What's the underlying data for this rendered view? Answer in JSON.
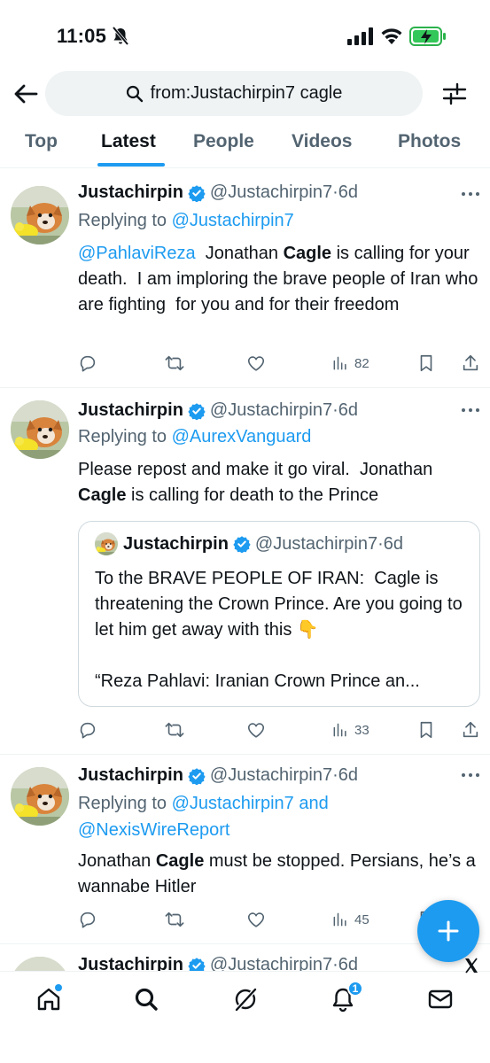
{
  "status_bar": {
    "time": "11:05"
  },
  "search": {
    "query": "from:Justachirpin7 cagle"
  },
  "tabs": [
    {
      "label": "Top"
    },
    {
      "label": "Latest"
    },
    {
      "label": "People"
    },
    {
      "label": "Videos"
    },
    {
      "label": "Photos"
    }
  ],
  "tweets": [
    {
      "name": "Justachirpin",
      "handle": "@Justachirpin7",
      "sep": " · ",
      "time": "6d",
      "replying_prefix": "Replying to ",
      "replying_to": "@Justachirpin7",
      "mention": "@PahlaviReza",
      "text_a": "  Jonathan ",
      "bold": "Cagle",
      "text_b": " is calling for your death.  I am imploring the brave people of Iran who are fighting  for you and for their freedom",
      "views": "82"
    },
    {
      "name": "Justachirpin",
      "handle": "@Justachirpin7",
      "sep": " · ",
      "time": "6d",
      "replying_prefix": "Replying to ",
      "replying_to": "@AurexVanguard",
      "text_a": "Please repost and make it go viral.  Jonathan ",
      "bold": "Cagle",
      "text_b": " is calling for death to the Prince",
      "quote": {
        "name": "Justachirpin",
        "handle": "@Justachirpin7",
        "sep": " · ",
        "time": "6d",
        "text": "To the BRAVE PEOPLE OF IRAN:  Cagle is threatening the Crown Prince. Are you going to let him get away with this 👇",
        "text2": "“Reza Pahlavi: Iranian Crown Prince an..."
      },
      "views": "33"
    },
    {
      "name": "Justachirpin",
      "handle": "@Justachirpin7",
      "sep": " · ",
      "time": "6d",
      "replying_prefix": "Replying to ",
      "replying_to": "@Justachirpin7 and",
      "replying_to2": "@NexisWireReport",
      "text_a": "Jonathan ",
      "bold": "Cagle",
      "text_b": " must be stopped. Persians, he’s a wannabe Hitler",
      "views": "45"
    },
    {
      "name": "Justachirpin",
      "handle": "@Justachirpin7",
      "sep": " · ",
      "time": "6d"
    }
  ],
  "notifications": {
    "badge": "1"
  },
  "colors": {
    "accent": "#1d9bf0",
    "text": "#0f1419",
    "secondary": "#536471"
  }
}
